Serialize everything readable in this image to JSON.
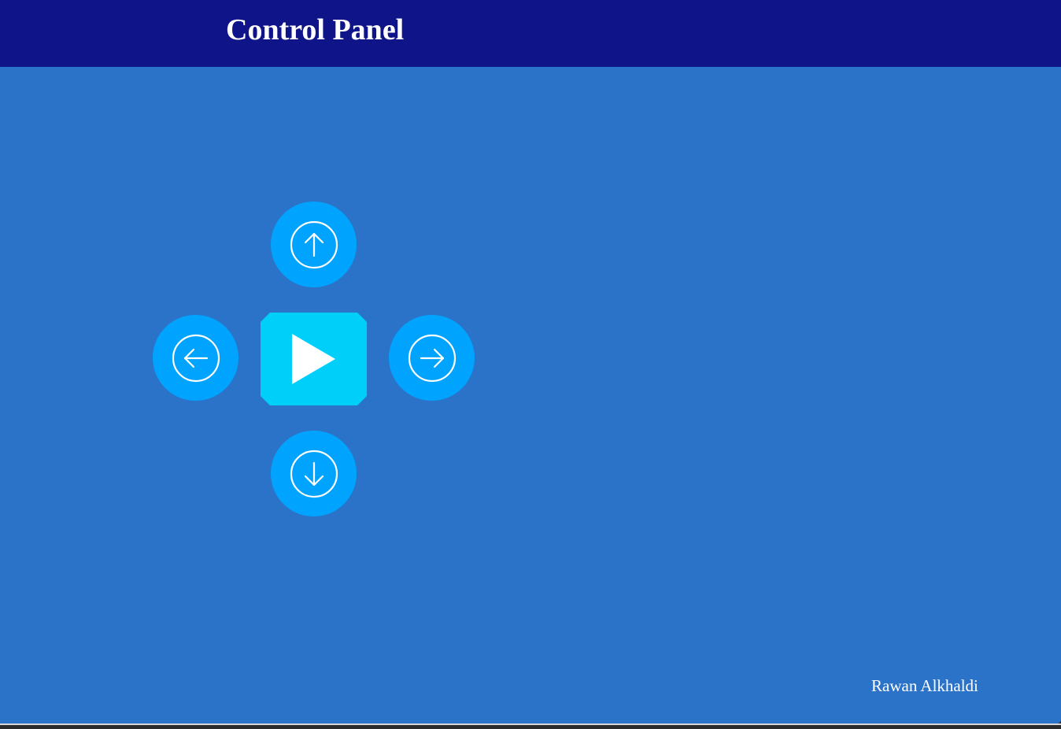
{
  "header": {
    "title": "Control Panel"
  },
  "controls": {
    "up": {
      "icon": "arrow-up-circle-icon"
    },
    "left": {
      "icon": "arrow-left-circle-icon"
    },
    "play": {
      "icon": "play-icon"
    },
    "right": {
      "icon": "arrow-right-circle-icon"
    },
    "down": {
      "icon": "arrow-down-circle-icon"
    }
  },
  "footer": {
    "author": "Rawan Alkhaldi"
  },
  "colors": {
    "header_bg": "#0f1589",
    "main_bg": "#2b73c8",
    "direction_button": "#00a4ff",
    "play_button": "#00d0f9",
    "text": "#ffffff"
  }
}
